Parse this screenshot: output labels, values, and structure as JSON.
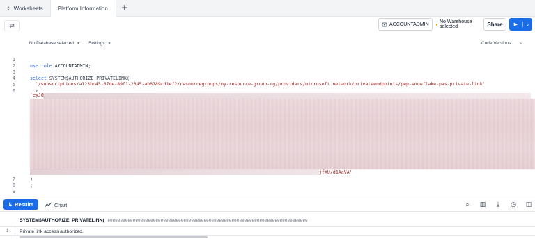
{
  "tabs": {
    "back_label": "Worksheets",
    "active_label": "Platform Information"
  },
  "toolbar": {
    "role": "ACCOUNTADMIN",
    "warehouse": "No Warehouse selected",
    "share_label": "Share"
  },
  "subbar": {
    "database": "No Database selected",
    "settings": "Settings",
    "code_versions": "Code Versions"
  },
  "editor": {
    "line_numbers": [
      "1",
      "2",
      "3",
      "4",
      "5",
      "6",
      "7",
      "8",
      "9"
    ],
    "line2_kw1": "use",
    "line2_kw2": "role",
    "line2_rest": " ACCOUNTADMIN;",
    "line4_kw": "select",
    "line4_rest": " SYSTEM$AUTHORIZE_PRIVATELINK(",
    "line5": "  '/subscriptions/a123bc45-67de-89f1-2345-ab6789cd1ef2/resourcegroups/my-resource-group-rg/providers/microsoft.network/privateendpoints/pep-snowflake-pas-private-link'",
    "line5b": "  ,",
    "line6_start": "'eyJ0",
    "line6_end": "jfXU/d1AaVA'",
    "line7": ")",
    "line8": ";"
  },
  "results": {
    "results_tab": "Results",
    "chart_tab": "Chart",
    "column_header": "SYSTEM$AUTHORIZE_PRIVATELINK(",
    "column_tail": "'eeeeeeeeeeeeeeeeeeeeeeeeeeeeeeeeeeeeeeeeeeeeeeeeeeeeeeeeeeeeeeeeeeeeeeeeeeeeeee",
    "row_number": "1",
    "row_value": "Private link access authorized."
  },
  "colors": {
    "accent": "#1a6ce7",
    "string": "#9b1c1c",
    "keyword": "#2563eb"
  }
}
